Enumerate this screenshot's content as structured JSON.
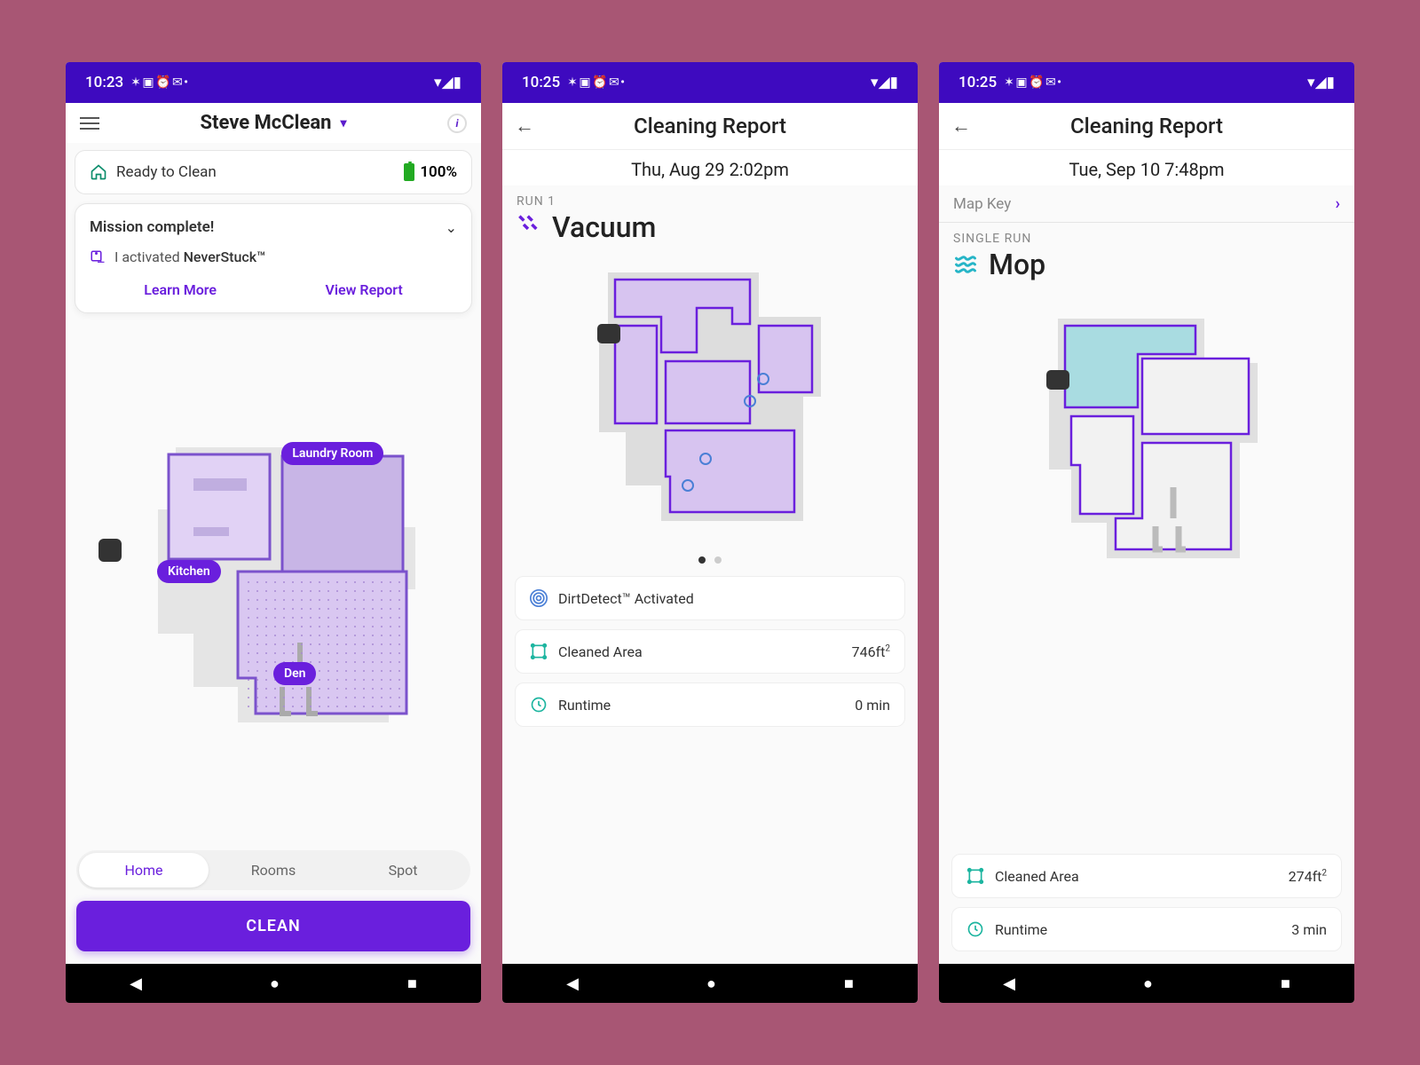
{
  "phoneA": {
    "time": "10:23",
    "robot_name": "Steve McClean",
    "ready": "Ready to Clean",
    "battery": "100%",
    "mission_title": "Mission complete!",
    "mission_line_prefix": "I activated",
    "mission_line_strong": "NeverStuck™",
    "learn_more": "Learn More",
    "view_report": "View Report",
    "rooms": {
      "kitchen": "Kitchen",
      "laundry": "Laundry Room",
      "den": "Den"
    },
    "tabs": {
      "home": "Home",
      "rooms": "Rooms",
      "spot": "Spot"
    },
    "clean_btn": "CLEAN"
  },
  "phoneB": {
    "time": "10:25",
    "title": "Cleaning Report",
    "date": "Thu, Aug 29 2:02pm",
    "run_label": "RUN 1",
    "run_type": "Vacuum",
    "dirtdetect": "DirtDetect™ Activated",
    "cleaned_area_label": "Cleaned Area",
    "cleaned_area_val": "746ft",
    "runtime_label": "Runtime",
    "runtime_val": "0 min"
  },
  "phoneC": {
    "time": "10:25",
    "title": "Cleaning Report",
    "date": "Tue, Sep 10 7:48pm",
    "map_key": "Map Key",
    "run_label": "SINGLE RUN",
    "run_type": "Mop",
    "cleaned_area_label": "Cleaned Area",
    "cleaned_area_val": "274ft",
    "runtime_label": "Runtime",
    "runtime_val": "3 min"
  }
}
